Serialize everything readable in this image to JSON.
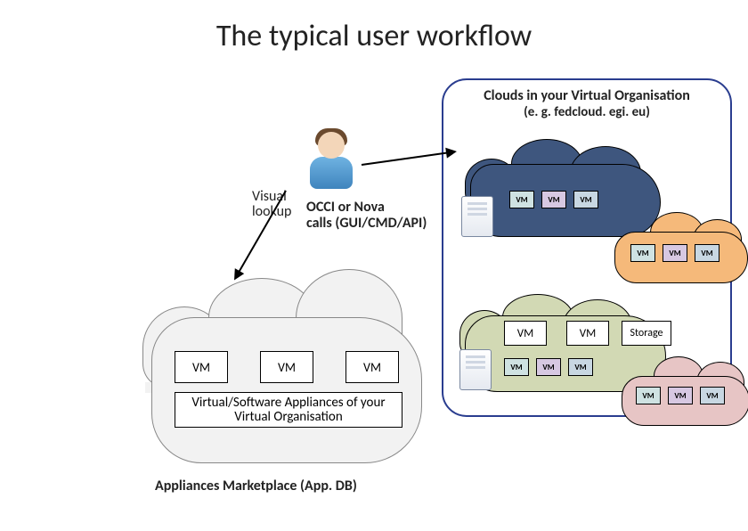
{
  "title": "The typical user workflow",
  "visual_lookup": {
    "line1": "Visual",
    "line2": "lookup"
  },
  "occi": {
    "line1": "OCCI or Nova",
    "line2": "calls (GUI/CMD/API)"
  },
  "clouds_panel": {
    "header_line1": "Clouds in your Virtual Organisation",
    "header_line2": "(e. g. fedcloud. egi. eu)"
  },
  "vm_label": "VM",
  "storage_label": "Storage",
  "cloud_blue": {
    "vm_boxes": [
      "VM",
      "VM",
      "VM"
    ]
  },
  "cloud_orange": {
    "vm_boxes": [
      "VM",
      "VM",
      "VM"
    ]
  },
  "cloud_green": {
    "vm_big": [
      "VM",
      "VM"
    ],
    "storage": "Storage",
    "vm_small": [
      "VM",
      "VM",
      "VM"
    ]
  },
  "cloud_pink": {
    "vm_boxes": [
      "VM",
      "VM",
      "VM"
    ]
  },
  "marketplace": {
    "vm_boxes": [
      "VM",
      "VM",
      "VM"
    ],
    "appliances_label": "Virtual/Software Appliances of your Virtual Organisation",
    "caption": "Appliances Marketplace (App. DB)"
  }
}
